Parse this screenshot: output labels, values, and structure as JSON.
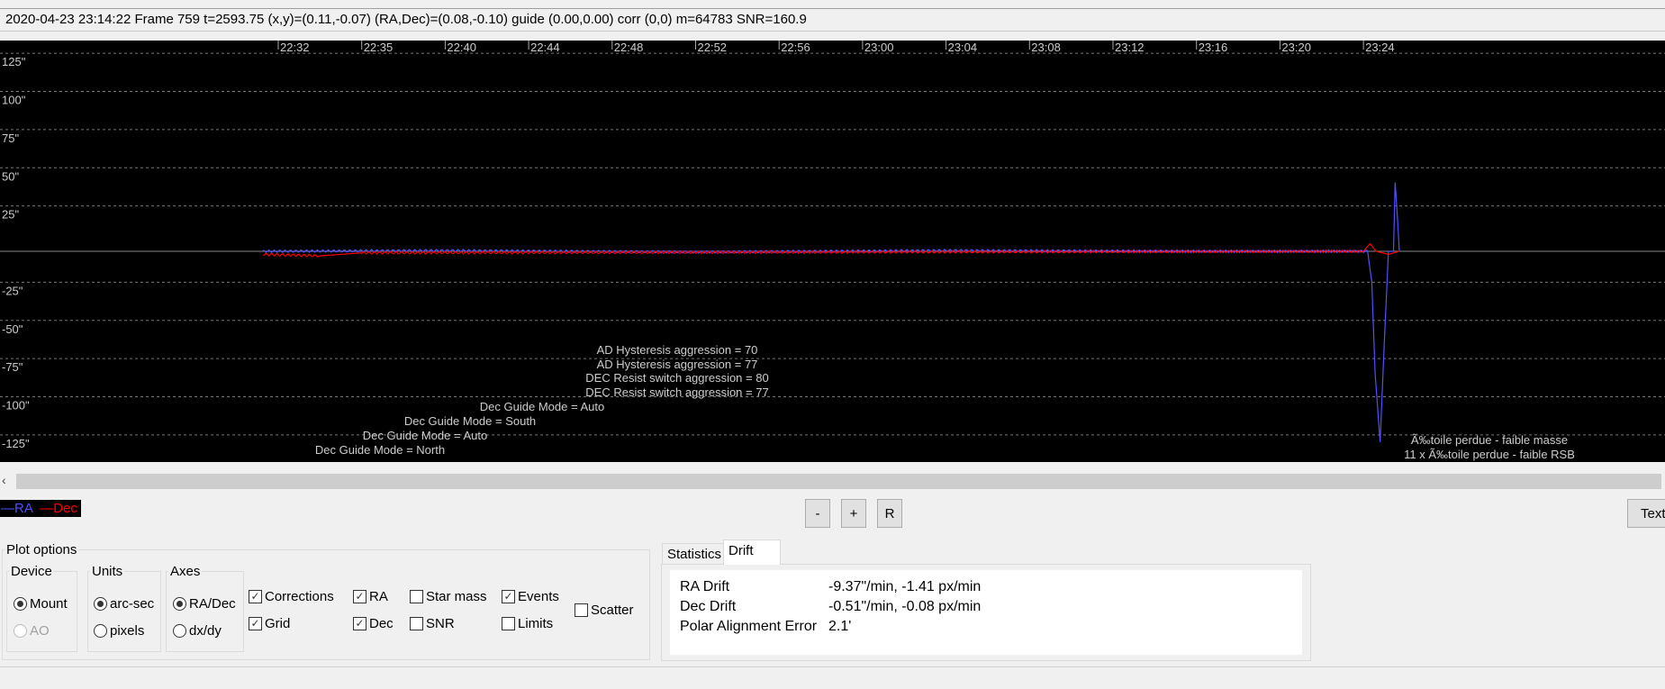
{
  "status_bar": "2020-04-23 23:14:22 Frame 759 t=2593.75 (x,y)=(0.11,-0.07) (RA,Dec)=(0.08,-0.10) guide (0.00,0.00) corr (0,0) m=64783 SNR=160.9",
  "chart_data": {
    "type": "line",
    "x_ticks": [
      "22:32",
      "22:35",
      "22:40",
      "22:44",
      "22:48",
      "22:52",
      "22:56",
      "23:00",
      "23:04",
      "23:08",
      "23:12",
      "23:16",
      "23:20",
      "23:24"
    ],
    "y_ticks": [
      "125\"",
      "100\"",
      "75\"",
      "50\"",
      "25\"",
      "",
      "-25\"",
      "-50\"",
      "-75\"",
      "-100\"",
      "-125\""
    ],
    "y_tick_values": [
      125,
      100,
      75,
      50,
      25,
      0,
      -25,
      -50,
      -75,
      -100,
      -125
    ],
    "ylim": [
      -137,
      137
    ],
    "x_unit": "tick index",
    "grid": true,
    "series": [
      {
        "name": "RA",
        "color": "#5050ff",
        "points": [
          [
            -0.18,
            0
          ],
          [
            2,
            0.5
          ],
          [
            5,
            -0.5
          ],
          [
            8,
            0.5
          ],
          [
            11,
            0
          ],
          [
            13.05,
            0
          ],
          [
            13.1,
            -20
          ],
          [
            13.14,
            -80
          ],
          [
            13.2,
            -125
          ],
          [
            13.25,
            -60
          ],
          [
            13.3,
            0
          ],
          [
            13.36,
            0
          ],
          [
            13.38,
            45
          ],
          [
            13.41,
            20
          ],
          [
            13.43,
            0
          ]
        ]
      },
      {
        "name": "Dec",
        "color": "#ff0000",
        "points": [
          [
            -0.18,
            -2
          ],
          [
            0.5,
            -3
          ],
          [
            1,
            -1
          ],
          [
            13.0,
            0
          ],
          [
            13.08,
            5
          ],
          [
            13.15,
            0
          ],
          [
            13.3,
            -2
          ],
          [
            13.43,
            0
          ]
        ]
      }
    ],
    "events_left": [
      "AD Hysteresis aggression = 70",
      "AD Hysteresis aggression = 77",
      "DEC Resist switch aggression = 80",
      "DEC Resist switch aggression = 77",
      "Dec Guide Mode = Auto",
      "Dec Guide Mode = South",
      "Dec Guide Mode = Auto",
      "Dec Guide Mode = North"
    ],
    "events_right": [
      "Ã‰toile perdue - faible masse",
      "11 x Ã‰toile perdue - faible RSB"
    ]
  },
  "legend": {
    "ra": "—RA",
    "dec": "—Dec"
  },
  "buttons": {
    "zoom_out": "-",
    "zoom_in": "+",
    "reset": "R",
    "text": "Text"
  },
  "plot_options": {
    "title": "Plot options",
    "device": {
      "title": "Device",
      "mount": "Mount",
      "ao": "AO"
    },
    "units": {
      "title": "Units",
      "arcsec": "arc-sec",
      "pixels": "pixels"
    },
    "axes": {
      "title": "Axes",
      "radec": "RA/Dec",
      "dxdy": "dx/dy"
    },
    "checks": {
      "corrections": "Corrections",
      "grid": "Grid",
      "ra": "RA",
      "dec": "Dec",
      "star_mass": "Star mass",
      "snr": "SNR",
      "events": "Events",
      "limits": "Limits",
      "scatter": "Scatter"
    }
  },
  "tabs": {
    "statistics": "Statistics",
    "drift": "Drift"
  },
  "drift": {
    "ra_label": "RA Drift",
    "ra_value": "-9.37\"/min, -1.41 px/min",
    "dec_label": "Dec Drift",
    "dec_value": "-0.51\"/min, -0.08 px/min",
    "pae_label": "Polar Alignment Error",
    "pae_value": "2.1'"
  }
}
